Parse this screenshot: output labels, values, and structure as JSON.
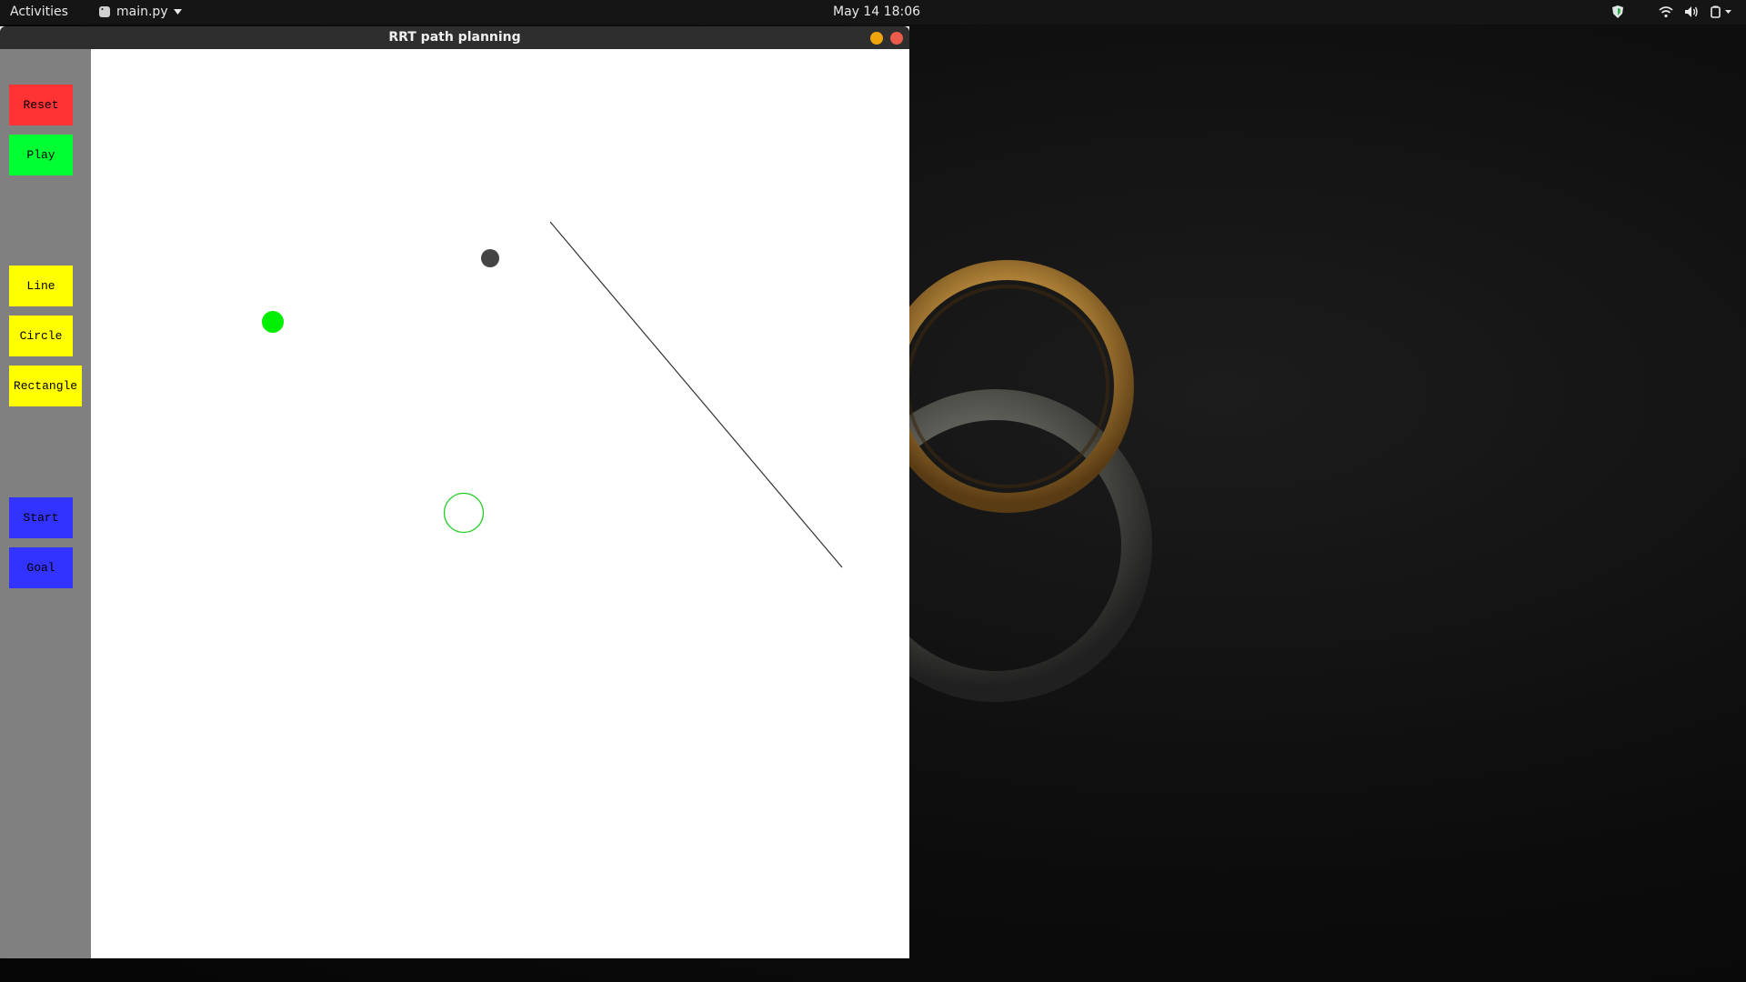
{
  "topbar": {
    "activities": "Activities",
    "app_name": "main.py",
    "clock": "May 14  18:06",
    "icons": [
      "shield-icon",
      "wifi-icon",
      "volume-icon",
      "power-icon"
    ]
  },
  "window": {
    "title": "RRT path planning"
  },
  "toolbar": {
    "reset": "Reset",
    "play": "Play",
    "line": "Line",
    "circle": "Circle",
    "rectangle": "Rectangle",
    "start": "Start",
    "goal": "Goal"
  },
  "colors": {
    "reset": "#ff3333",
    "play": "#00ff33",
    "shape_tools": "#ffff00",
    "endpoint_tools": "#3333ff",
    "start_marker": "#00ee00",
    "obstacle_point": "#444444",
    "goal_ring": "#22cc22",
    "line": "#333333"
  }
}
